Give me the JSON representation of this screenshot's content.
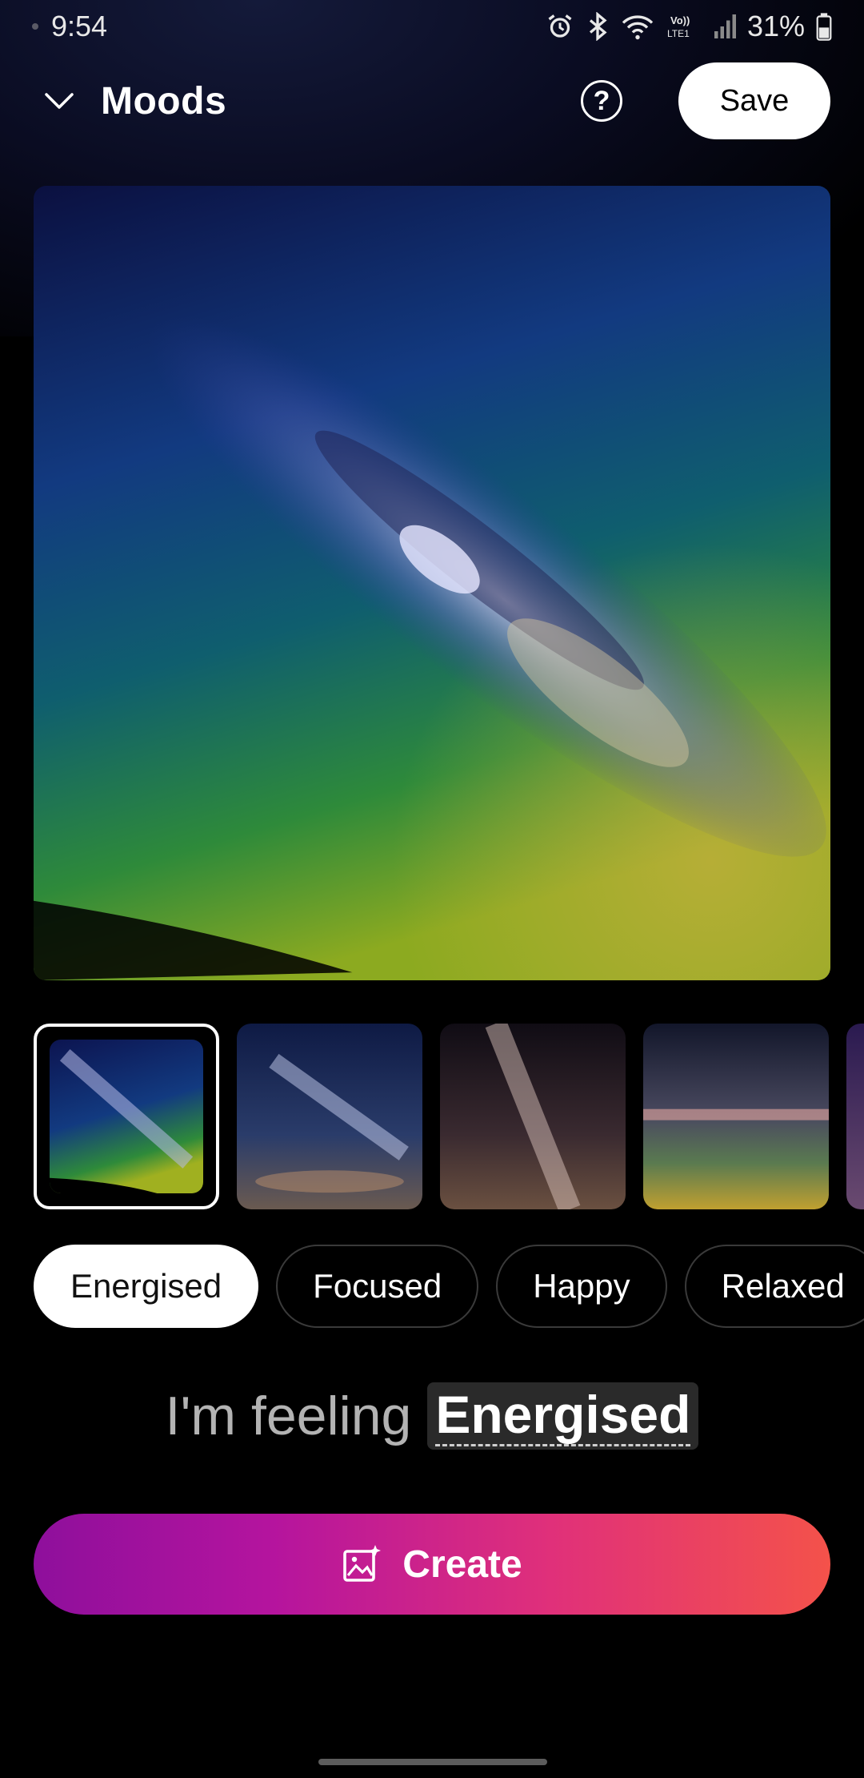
{
  "status_bar": {
    "time": "9:54",
    "battery": "31%",
    "network": "LTE1",
    "icons": [
      "alarm-icon",
      "bluetooth-icon",
      "wifi-icon",
      "volte-icon",
      "signal-icon",
      "battery-icon"
    ]
  },
  "header": {
    "title": "Moods",
    "help_label": "?",
    "save_label": "Save"
  },
  "thumbnails": {
    "count_visible": 5,
    "selected_index": 0
  },
  "moods": {
    "chips": [
      "Energised",
      "Focused",
      "Happy",
      "Relaxed"
    ],
    "selected": "Energised"
  },
  "feeling": {
    "prefix": "I'm feeling",
    "mood": "Energised"
  },
  "create": {
    "label": "Create",
    "icon": "ai-image-icon"
  },
  "colors": {
    "save_bg": "#ffffff",
    "create_gradient_start": "#8e0f9c",
    "create_gradient_end": "#f4524a",
    "chip_active_bg": "#ffffff"
  }
}
